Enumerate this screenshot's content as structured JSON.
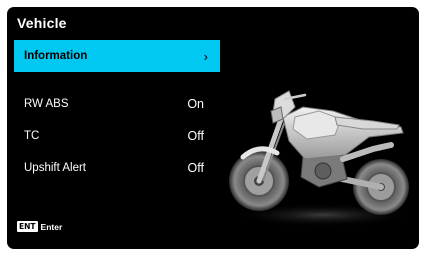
{
  "header": {
    "title": "Vehicle"
  },
  "menu": {
    "items": [
      {
        "label": "Information",
        "value": "›"
      },
      {
        "label": "RW ABS",
        "value": "On"
      },
      {
        "label": "TC",
        "value": "Off"
      },
      {
        "label": "Upshift Alert",
        "value": "Off"
      }
    ]
  },
  "footer": {
    "key_label": "ENT",
    "action_label": "Enter"
  },
  "colors": {
    "accent": "#00c8f0",
    "background": "#000000",
    "text": "#ffffff"
  },
  "image": {
    "subject": "motorcycle-illustration"
  }
}
